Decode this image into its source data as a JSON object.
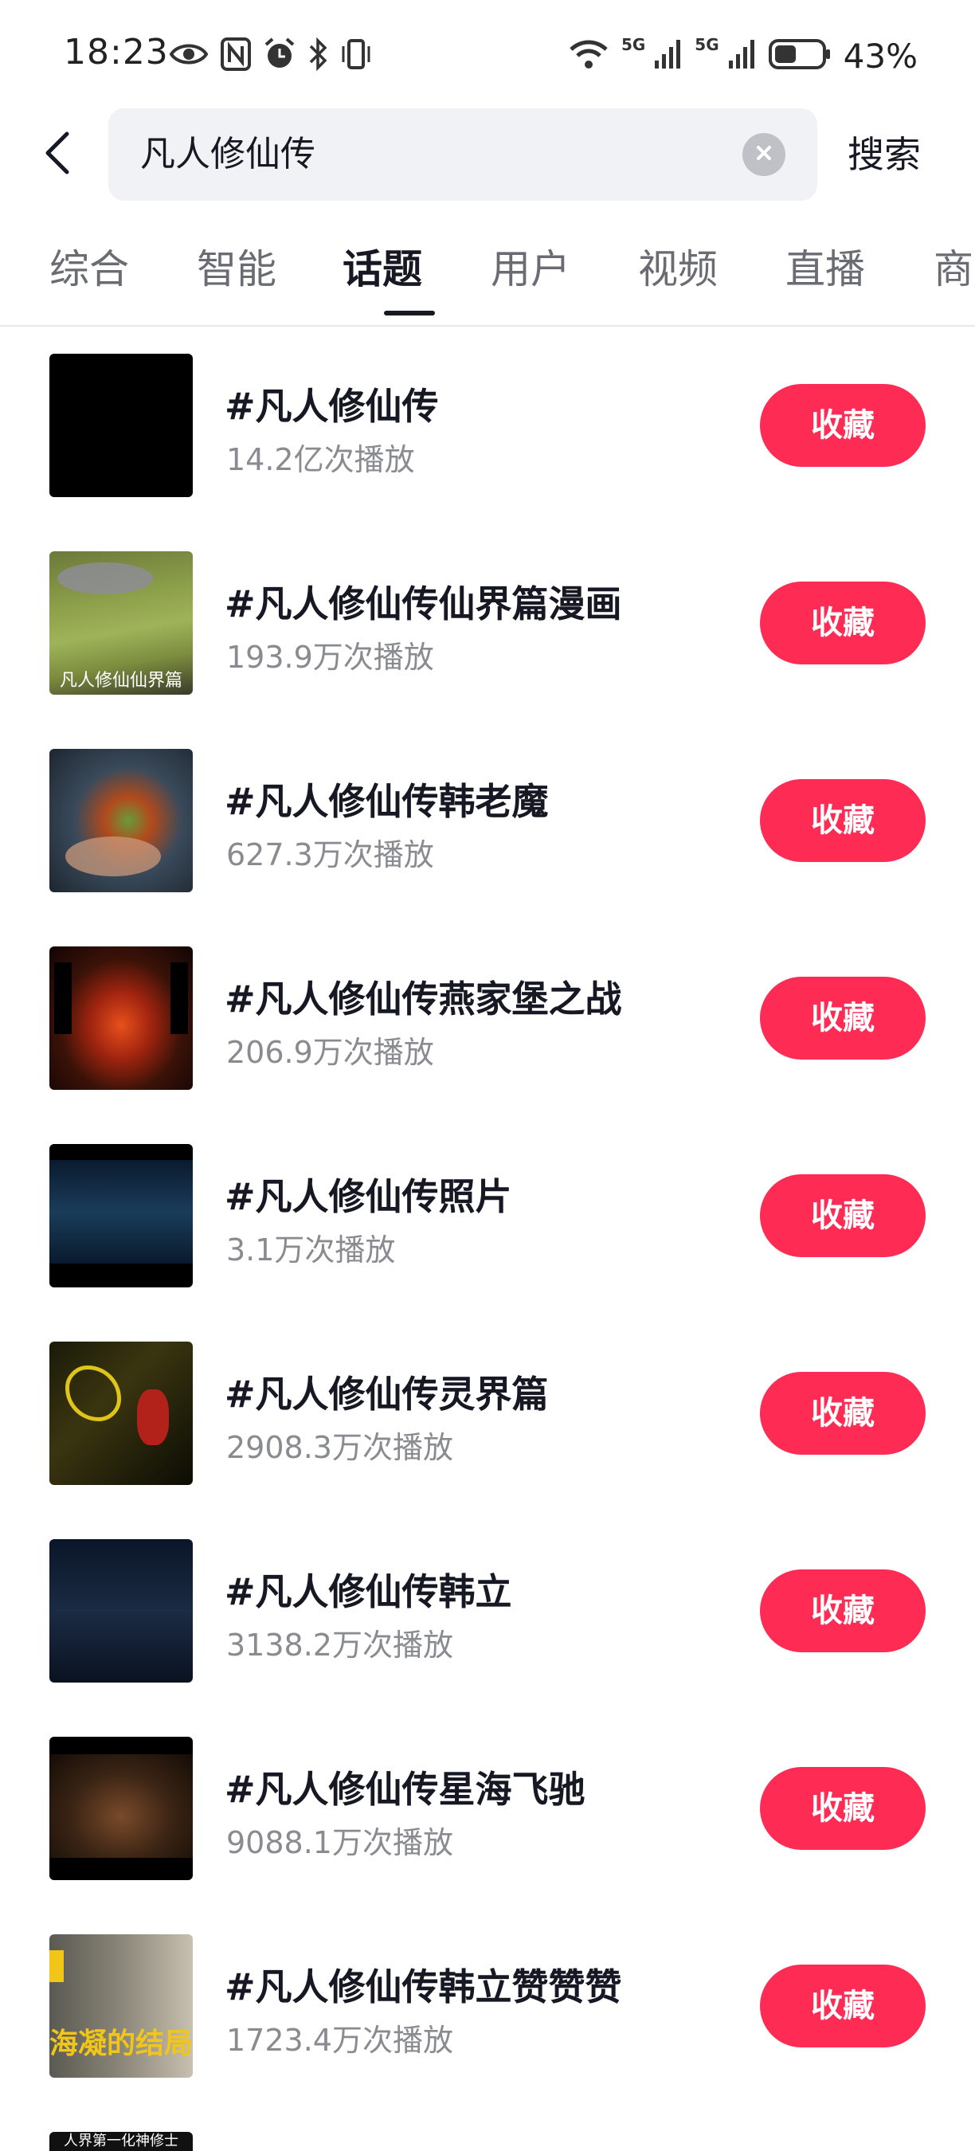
{
  "status_bar": {
    "time": "18:23",
    "sig1_label": "5G",
    "sig2_label": "5G",
    "battery_pct": "43%"
  },
  "search": {
    "query": "凡人修仙传",
    "submit_label": "搜索"
  },
  "tabs": [
    {
      "label": "综合"
    },
    {
      "label": "智能"
    },
    {
      "label": "话题",
      "active": true
    },
    {
      "label": "用户"
    },
    {
      "label": "视频"
    },
    {
      "label": "直播"
    },
    {
      "label": "商"
    }
  ],
  "topics": [
    {
      "title": "#凡人修仙传",
      "plays": "14.2亿次播放",
      "button": "收藏",
      "thumb_caption": ""
    },
    {
      "title": "#凡人修仙传仙界篇漫画",
      "plays": "193.9万次播放",
      "button": "收藏",
      "thumb_caption": "凡人修仙仙界篇"
    },
    {
      "title": "#凡人修仙传韩老魔",
      "plays": "627.3万次播放",
      "button": "收藏",
      "thumb_caption": ""
    },
    {
      "title": "#凡人修仙传燕家堡之战",
      "plays": "206.9万次播放",
      "button": "收藏",
      "thumb_caption": ""
    },
    {
      "title": "#凡人修仙传照片",
      "plays": "3.1万次播放",
      "button": "收藏",
      "thumb_caption": ""
    },
    {
      "title": "#凡人修仙传灵界篇",
      "plays": "2908.3万次播放",
      "button": "收藏",
      "thumb_caption": ""
    },
    {
      "title": "#凡人修仙传韩立",
      "plays": "3138.2万次播放",
      "button": "收藏",
      "thumb_caption": ""
    },
    {
      "title": "#凡人修仙传星海飞驰",
      "plays": "9088.1万次播放",
      "button": "收藏",
      "thumb_caption": ""
    },
    {
      "title": "#凡人修仙传韩立赞赞赞",
      "plays": "1723.4万次播放",
      "button": "收藏",
      "thumb_caption": "海凝的结局"
    }
  ],
  "partial_row_caption": "人界第一化神修士",
  "colors": {
    "accent": "#fe2c55",
    "search_bg": "#f1f2f5",
    "text_primary": "#161823",
    "text_secondary": "#8a8b91"
  }
}
